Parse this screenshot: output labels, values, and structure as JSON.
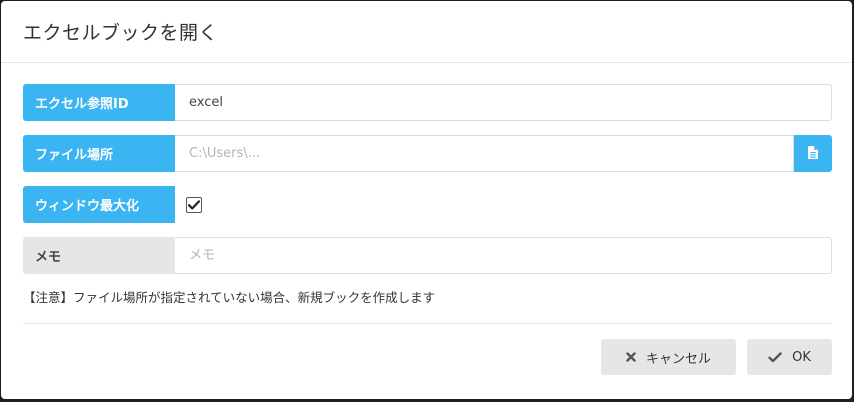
{
  "dialog": {
    "title": "エクセルブックを開く"
  },
  "form": {
    "excel_ref": {
      "label": "エクセル参照ID",
      "value": "excel"
    },
    "file_location": {
      "label": "ファイル場所",
      "placeholder": "C:\\Users\\..."
    },
    "maximize": {
      "label": "ウィンドウ最大化",
      "checked": true
    },
    "memo": {
      "label": "メモ",
      "placeholder": "メモ"
    },
    "note": "【注意】ファイル場所が指定されていない場合、新規ブックを作成します"
  },
  "footer": {
    "cancel_label": "キャンセル",
    "ok_label": "OK"
  },
  "colors": {
    "accent": "#3bb4f2",
    "label_gray": "#e6e6e6",
    "button_gray": "#e6e6e6"
  },
  "icons": {
    "file": "document-icon",
    "check": "checkmark-icon",
    "cancel": "x-icon",
    "ok": "check-icon"
  }
}
